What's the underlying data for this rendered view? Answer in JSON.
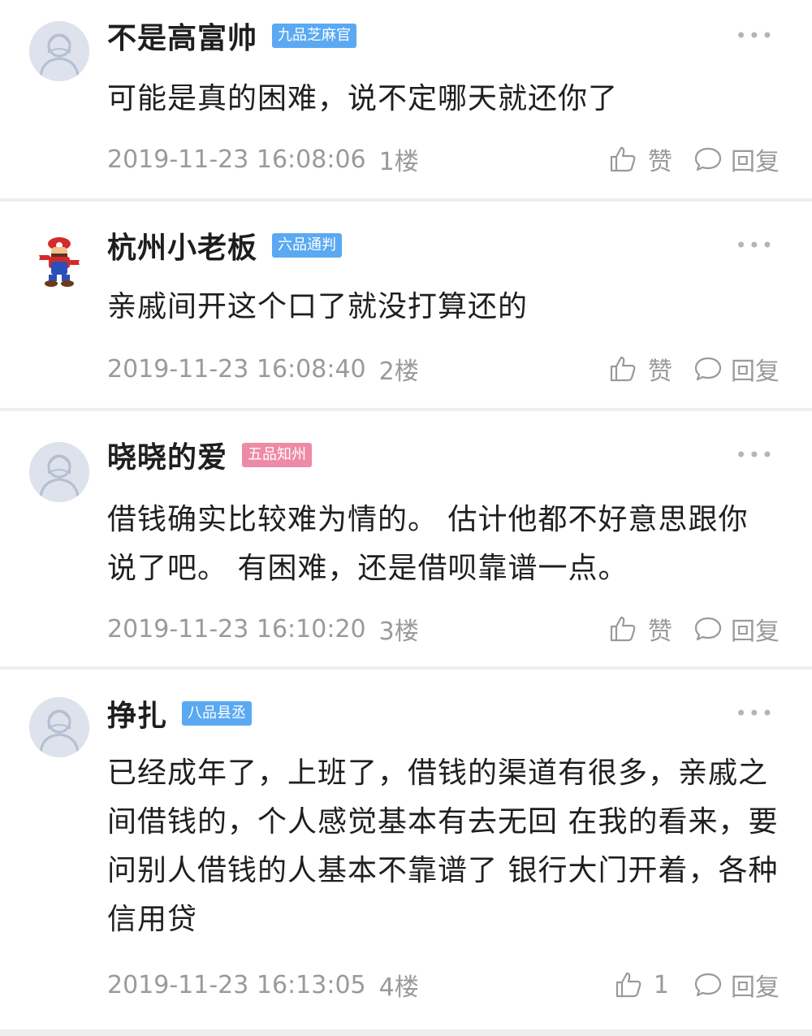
{
  "comments": [
    {
      "username": "不是高富帅",
      "rank": "九品芝麻官",
      "rank_color": "#5aa9f2",
      "avatar": "default-avatar-icon",
      "text": "可能是真的困难，说不定哪天就还你了",
      "timestamp": "2019-11-23 16:08:06",
      "floor": "1楼",
      "like_label": "赞",
      "reply_label": "回复"
    },
    {
      "username": "杭州小老板",
      "rank": "六品通判",
      "rank_color": "#5aa9f2",
      "avatar": "mario-avatar-icon",
      "text": "亲戚间开这个口了就没打算还的",
      "timestamp": "2019-11-23 16:08:40",
      "floor": "2楼",
      "like_label": "赞",
      "reply_label": "回复"
    },
    {
      "username": "晓晓的爱",
      "rank": "五品知州",
      "rank_color": "#ee8aa6",
      "avatar": "default-avatar-icon",
      "text": "借钱确实比较难为情的。 估计他都不好意思跟你说了吧。 有困难，还是借呗靠谱一点。",
      "timestamp": "2019-11-23 16:10:20",
      "floor": "3楼",
      "like_label": "赞",
      "reply_label": "回复"
    },
    {
      "username": "挣扎",
      "rank": "八品县丞",
      "rank_color": "#5aa9f2",
      "avatar": "default-avatar-icon",
      "text": "已经成年了，上班了，借钱的渠道有很多，亲戚之间借钱的，个人感觉基本有去无回 在我的看来，要问别人借钱的人基本不靠谱了 银行大门开着，各种信用贷",
      "timestamp": "2019-11-23 16:13:05",
      "floor": "4楼",
      "like_label": "1",
      "reply_label": "回复"
    }
  ],
  "icons": {
    "more": "more-dots-icon",
    "like": "thumbs-up-icon",
    "reply": "speech-bubble-icon"
  }
}
